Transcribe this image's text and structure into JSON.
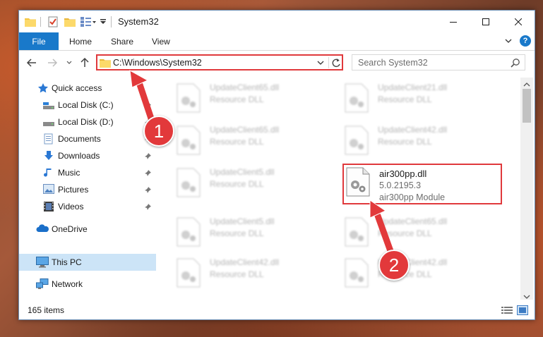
{
  "window": {
    "title": "System32"
  },
  "ribbon": {
    "tabs": {
      "file": "File",
      "home": "Home",
      "share": "Share",
      "view": "View"
    },
    "help": "?"
  },
  "nav": {
    "address": "C:\\Windows\\System32",
    "search_placeholder": "Search System32"
  },
  "sidebar": {
    "quick_access": "Quick access",
    "local_c": "Local Disk (C:)",
    "local_d": "Local Disk (D:)",
    "documents": "Documents",
    "downloads": "Downloads",
    "music": "Music",
    "pictures": "Pictures",
    "videos": "Videos",
    "onedrive": "OneDrive",
    "this_pc": "This PC",
    "network": "Network"
  },
  "files": [
    {
      "name": "UpdateClient65.dll",
      "desc": "Resource DLL"
    },
    {
      "name": "UpdateClient21.dll",
      "desc": "Resource DLL"
    },
    {
      "name": "UpdateClient65.dll",
      "desc": "Resource DLL"
    },
    {
      "name": "UpdateClient42.dll",
      "desc": "Resource DLL"
    },
    {
      "name": "UpdateClient5.dll",
      "desc": "Resource DLL"
    },
    {
      "name": "UpdateClient5.dll",
      "desc": "Resource DLL"
    },
    {
      "name": "UpdateClient65.dll",
      "desc": "Resource DLL"
    },
    {
      "name": "UpdateClient42.dll",
      "desc": "Resource DLL"
    },
    {
      "name": "UpdateClient42.dll",
      "desc": "Resource DLL"
    }
  ],
  "target_file": {
    "name": "air300pp.dll",
    "version": "5.0.2195.3",
    "desc": "air300pp Module"
  },
  "status": {
    "count": "165 items"
  },
  "annotations": {
    "step1": "1",
    "step2": "2"
  },
  "colors": {
    "accent": "#1979ca",
    "highlight": "#e0393c",
    "selection": "#cce4f7"
  }
}
